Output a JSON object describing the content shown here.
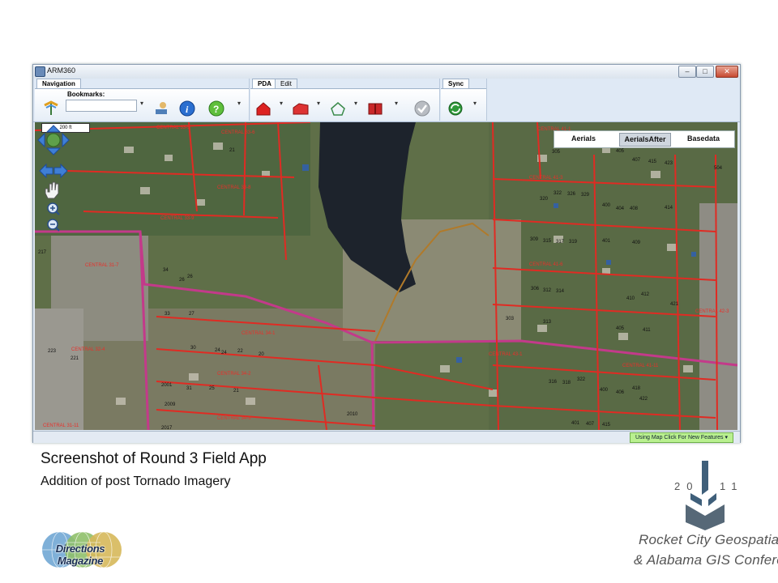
{
  "window": {
    "title": "ARM360",
    "controls": {
      "minimize": "–",
      "maximize": "□",
      "close": "✕"
    }
  },
  "ribbon": {
    "navigation": {
      "tab": "Navigation",
      "bookmarks_label": "Bookmarks:",
      "bookmarks_value": "",
      "icons": [
        "pan-tool-icon",
        "select-tool-icon",
        "info-icon",
        "help-icon"
      ]
    },
    "pda": {
      "tab": "PDA",
      "second_tab": "Edit",
      "icons": [
        "house-damage-icon",
        "building-damage-icon",
        "house-outline-icon",
        "book-icon",
        "checkmark-icon"
      ]
    },
    "sync": {
      "tab": "Sync",
      "icons": [
        "sync-icon"
      ]
    },
    "dropdown_glyph": "▾"
  },
  "map": {
    "layers": [
      "Aerials",
      "AerialsAfter",
      "Basedata"
    ],
    "active_layer": "AerialsAfter",
    "scale_text": "200 ft",
    "parcel_labels": [
      "CENTRAL 33-5",
      "CENTRAL 33-6",
      "CENTRAL 33-8",
      "CENTRAL 34-1",
      "CENTRAL 34-2",
      "CENTRAL 34-3",
      "CENTRAL 31-7",
      "CENTRAL 32-4",
      "CENTRAL 41-1",
      "CENTRAL 41-3",
      "CENTRAL 41-6",
      "CENTRAL 41-11",
      "CENTRAL 42-3",
      "CENTRAL 43-1",
      "CENTRAL 33-9",
      "CENTRAL 31-11"
    ],
    "lot_numbers": [
      "305",
      "307",
      "405",
      "407",
      "415",
      "423",
      "504",
      "322",
      "326",
      "329",
      "320",
      "400",
      "404",
      "408",
      "414",
      "309",
      "315",
      "317",
      "319",
      "401",
      "409",
      "312",
      "314",
      "306",
      "410",
      "412",
      "421",
      "303",
      "313",
      "405",
      "411",
      "316",
      "318",
      "322",
      "400",
      "406",
      "418",
      "422",
      "401",
      "407",
      "415",
      "33",
      "27",
      "30",
      "24",
      "22",
      "2001",
      "25",
      "21",
      "2009",
      "2017",
      "2010",
      "217",
      "223",
      "221",
      "20",
      "34",
      "26",
      "31",
      "26",
      "21",
      "24"
    ]
  },
  "status": {
    "message": "Using Map Click For New Features"
  },
  "slide": {
    "caption_title": "Screenshot of Round 3 Field App",
    "caption_subtitle": "Addition of post Tornado Imagery",
    "logo_left_text": "Directions Magazine",
    "logo_right_year_left": "20",
    "logo_right_year_right": "11",
    "logo_right_line1": "Rocket City Geospatial",
    "logo_right_line2": "& Alabama GIS Conference"
  },
  "colors": {
    "parcel_line": "#e02b23",
    "road_line": "#c33a8a",
    "water": "#1d232c",
    "status_green": "#b9f08f"
  }
}
